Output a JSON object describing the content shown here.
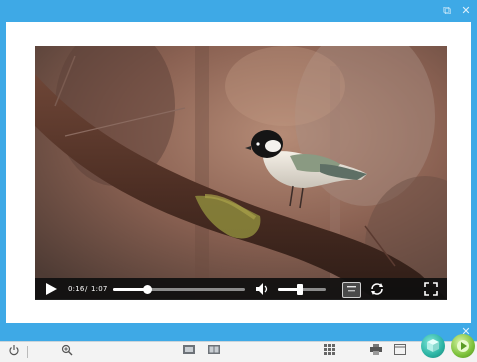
{
  "window": {
    "restore_glyph": "⧉",
    "close_glyph": "✕"
  },
  "player": {
    "current_time": "0:16",
    "separator": "/",
    "duration": "1:07",
    "progress": 0.26,
    "volume": 0.45
  },
  "panel": {
    "close_glyph": "✕"
  },
  "colors": {
    "frame_blue": "#3ea9e6",
    "control_bar": "#0f0f0f",
    "go_green": "#7cc13a",
    "teal_button": "#2bb3a3"
  },
  "icons": [
    "restore-icon",
    "close-icon",
    "play-icon",
    "volume-icon",
    "speed-icon",
    "loop-icon",
    "fullscreen-icon",
    "power-icon",
    "zoom-icon",
    "grid-icon",
    "print-icon"
  ]
}
